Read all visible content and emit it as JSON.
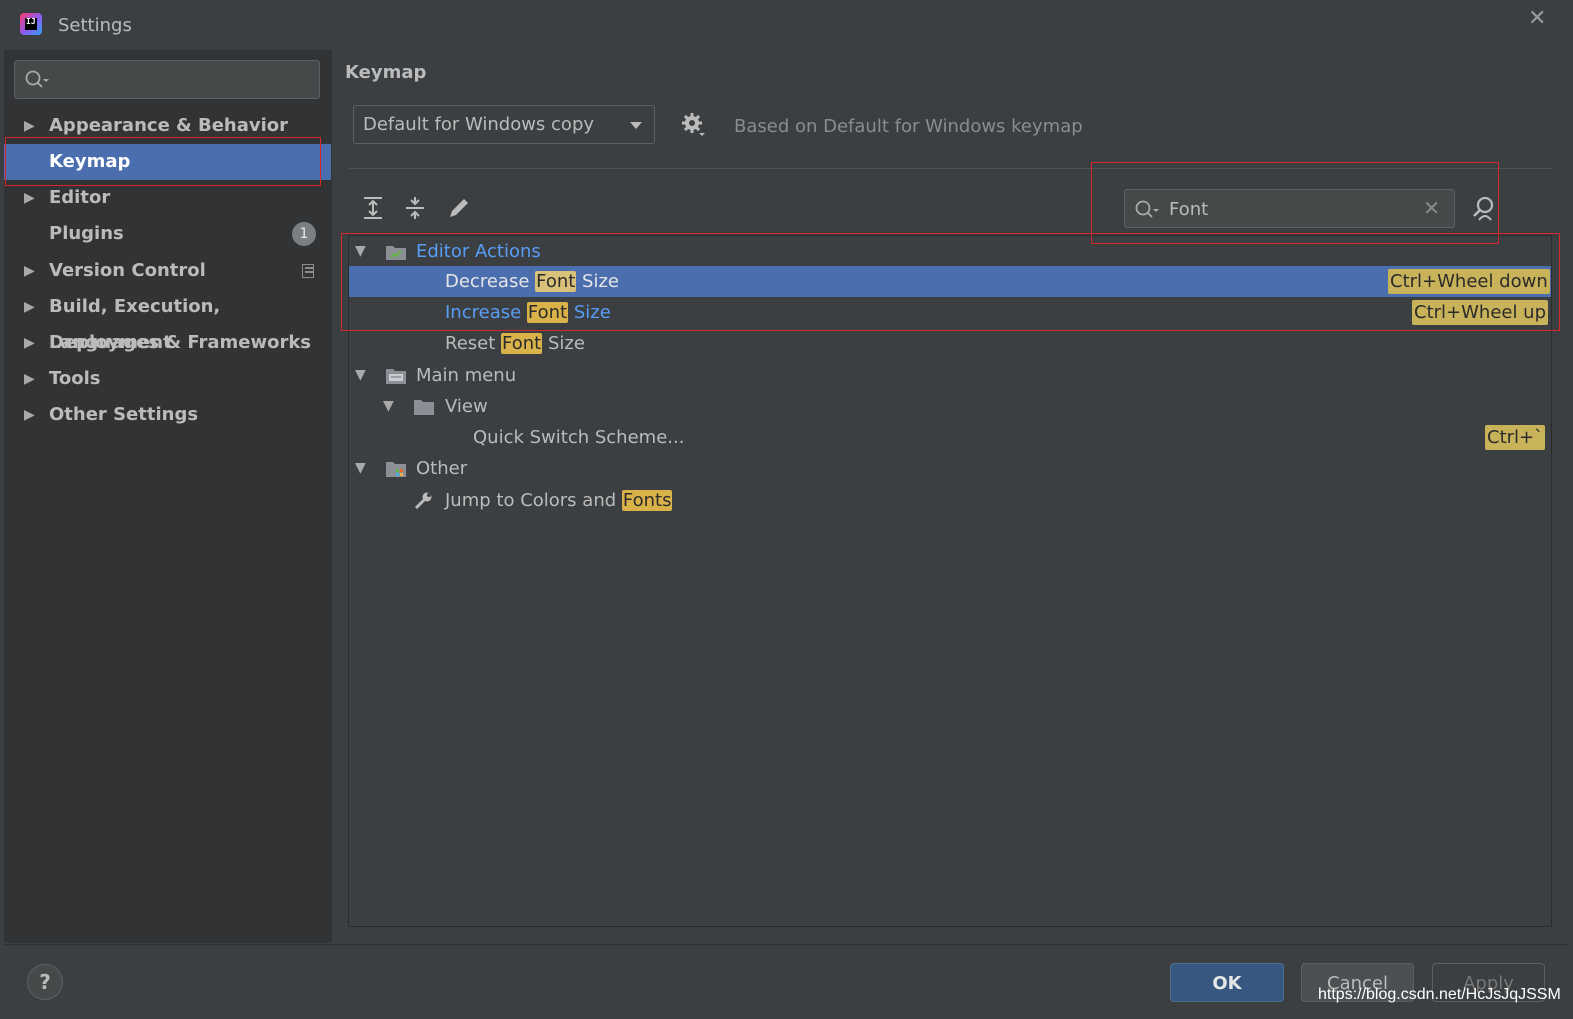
{
  "window": {
    "title": "Settings",
    "close": "✕"
  },
  "sidebar": {
    "search_placeholder": "",
    "items": [
      {
        "label": "Appearance & Behavior",
        "arrow": "▶"
      },
      {
        "label": "Keymap"
      },
      {
        "label": "Editor",
        "arrow": "▶"
      },
      {
        "label": "Plugins",
        "badge": "1"
      },
      {
        "label": "Version Control",
        "arrow": "▶"
      },
      {
        "label": "Build, Execution, Deployment",
        "arrow": "▶"
      },
      {
        "label": "Languages & Frameworks",
        "arrow": "▶"
      },
      {
        "label": "Tools",
        "arrow": "▶"
      },
      {
        "label": "Other Settings",
        "arrow": "▶"
      }
    ]
  },
  "main": {
    "title": "Keymap",
    "keymap_select": "Default for Windows copy",
    "based_on": "Based on Default for Windows keymap",
    "search_value": "Font",
    "tree": {
      "editor_actions": "Editor Actions",
      "decrease": {
        "pre": "Decrease ",
        "hl": "Font",
        "post": " Size",
        "shortcut": "Ctrl+Wheel down"
      },
      "increase": {
        "pre": "Increase ",
        "hl": "Font",
        "post": " Size",
        "shortcut": "Ctrl+Wheel up"
      },
      "reset": {
        "pre": "Reset ",
        "hl": "Font",
        "post": " Size"
      },
      "main_menu": "Main menu",
      "view": "View",
      "quick_switch": {
        "label": "Quick Switch Scheme...",
        "shortcut": "Ctrl+`"
      },
      "other": "Other",
      "jump": {
        "pre": "Jump to Colors and ",
        "hl": "Fonts"
      }
    }
  },
  "footer": {
    "help": "?",
    "ok": "OK",
    "cancel": "Cancel",
    "apply": "Apply",
    "watermark": "https://blog.csdn.net/HcJsJqJSSM"
  },
  "colors": {
    "background": "#3c3f41",
    "sidebar": "#313335",
    "selection": "#4b6eaf",
    "highlight": "#d9b24a",
    "link_blue": "#589df6",
    "annotation_red": "#d7262b"
  }
}
